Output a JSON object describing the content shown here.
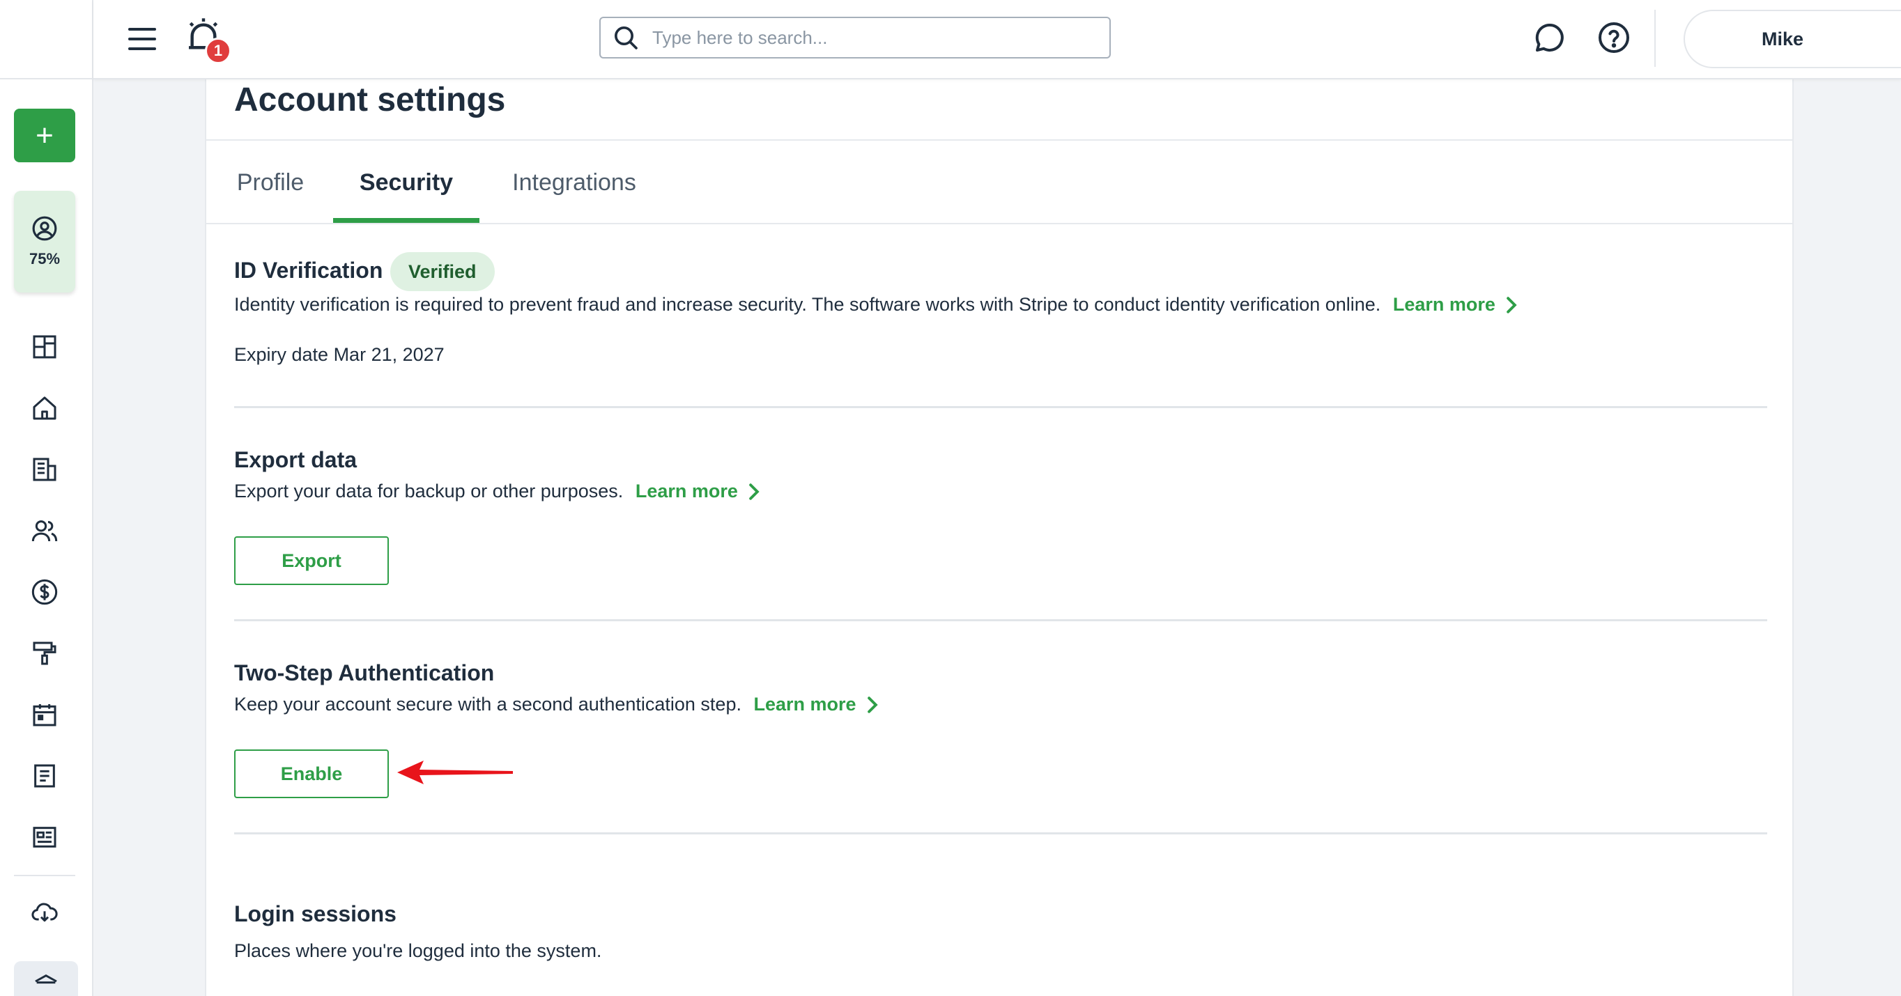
{
  "header": {
    "notifications_count": "1",
    "search_placeholder": "Type here to search...",
    "user_name": "Mike"
  },
  "rail": {
    "profile_progress": "75%"
  },
  "page": {
    "title": "Account settings",
    "tabs": [
      {
        "label": "Profile",
        "active": false
      },
      {
        "label": "Security",
        "active": true
      },
      {
        "label": "Integrations",
        "active": false
      }
    ]
  },
  "sections": {
    "id_verification": {
      "title": "ID Verification",
      "badge": "Verified",
      "description": "Identity verification is required to prevent fraud and increase security. The software works with Stripe to conduct identity verification online.",
      "learn_more": "Learn more",
      "expiry": "Expiry date Mar 21, 2027"
    },
    "export": {
      "title": "Export data",
      "description": "Export your data for backup or other purposes.",
      "learn_more": "Learn more",
      "button": "Export"
    },
    "two_step": {
      "title": "Two-Step Authentication",
      "description": "Keep your account secure with a second authentication step.",
      "learn_more": "Learn more",
      "button": "Enable"
    },
    "login_sessions": {
      "title": "Login sessions",
      "description": "Places where you're logged into the system."
    }
  },
  "colors": {
    "accent": "#2e9e47",
    "badge_bg": "#dff1e2",
    "notification": "#e03d3d",
    "annotation_arrow": "#e8141b"
  }
}
